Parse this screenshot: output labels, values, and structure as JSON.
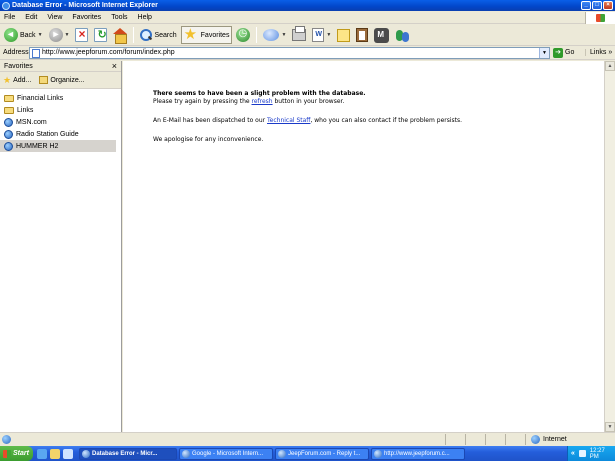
{
  "window": {
    "title": "Database Error - Microsoft Internet Explorer"
  },
  "menu": [
    "File",
    "Edit",
    "View",
    "Favorites",
    "Tools",
    "Help"
  ],
  "toolbar": {
    "back_label": "Back",
    "search_label": "Search",
    "favorites_label": "Favorites"
  },
  "address": {
    "label": "Address",
    "url": "http://www.jeepforum.com/forum/index.php",
    "go_label": "Go",
    "links_label": "Links"
  },
  "favorites": {
    "title": "Favorites",
    "add_label": "Add...",
    "organize_label": "Organize...",
    "items": [
      {
        "label": "Financial Links",
        "icon": "folder-icon"
      },
      {
        "label": "Links",
        "icon": "folder-icon"
      },
      {
        "label": "MSN.com",
        "icon": "ie-page-icon"
      },
      {
        "label": "Radio Station Guide",
        "icon": "ie-page-icon"
      },
      {
        "label": "HUMMER  H2",
        "icon": "ie-page-icon"
      }
    ]
  },
  "page": {
    "heading": "There seems to have been a slight problem with the database.",
    "line1_pre": "Please try again by pressing the ",
    "line1_link": "refresh",
    "line1_post": " button in your browser.",
    "line2_pre": "An E-Mail has been dispatched to our ",
    "line2_link": "Technical Staff",
    "line2_post": ", who you can also contact if the problem persists.",
    "line3": "We apologise for any inconvenience."
  },
  "status": {
    "zone": "Internet"
  },
  "taskbar": {
    "start_label": "Start",
    "tasks": [
      "Database Error - Micr...",
      "Google - Microsoft Intern...",
      "JeepForum.com - Reply t...",
      "http://www.jeepforum.c..."
    ],
    "clock": "12:27 PM",
    "chevron": "«"
  },
  "colors": {
    "titlebar": "#0246c9",
    "link": "#1a3ac9",
    "chrome": "#ece9d8",
    "start": "#3a9c2e"
  }
}
